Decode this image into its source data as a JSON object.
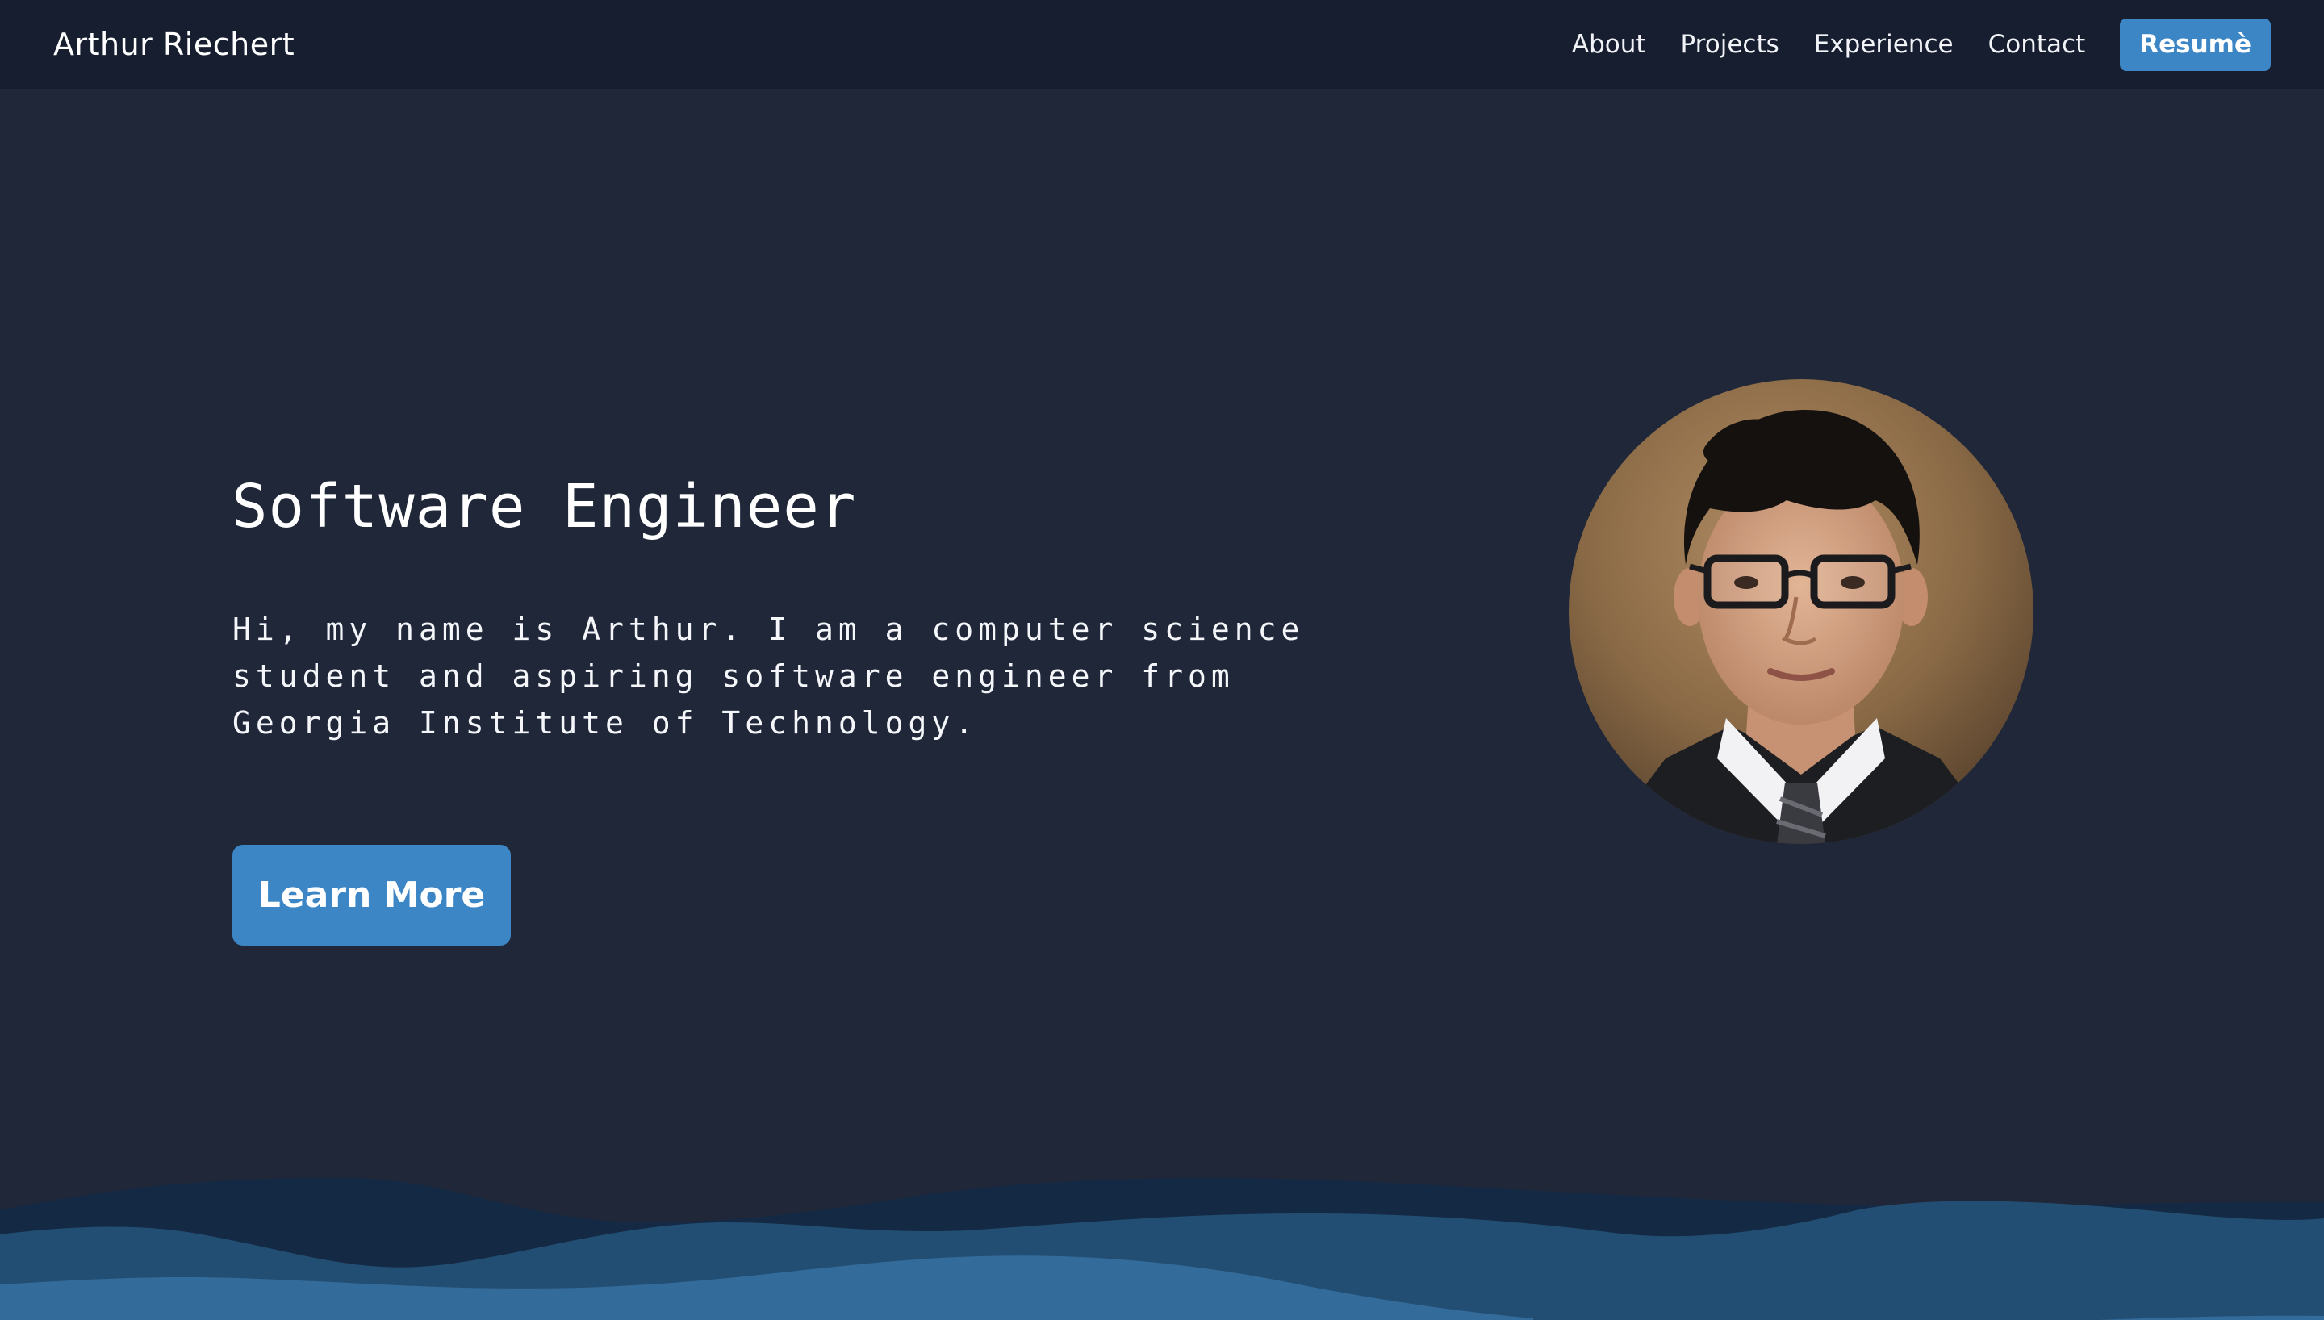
{
  "navbar": {
    "brand": "Arthur Riechert",
    "links": [
      "About",
      "Projects",
      "Experience",
      "Contact"
    ],
    "resume_label": "Resumè"
  },
  "hero": {
    "title": "Software Engineer",
    "description": "Hi, my name is Arthur. I am a computer science student and aspiring software engineer from Georgia Institute of Technology.",
    "cta_label": "Learn More"
  },
  "colors": {
    "background": "#1f2739",
    "navbar": "#171e30",
    "accent": "#3d86c6",
    "wave_dark": "#142a44",
    "wave_mid": "#234e73",
    "wave_light": "#336b9a"
  }
}
